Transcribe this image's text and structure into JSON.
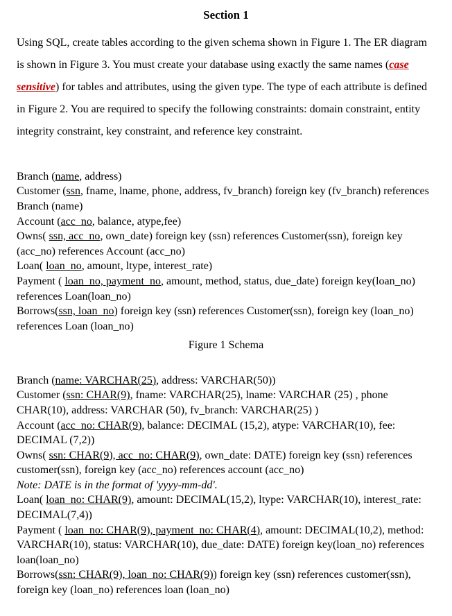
{
  "section_title": "Section 1",
  "intro": {
    "part1": "Using SQL, create tables according to the given schema shown in Figure 1. The ER diagram is shown in Figure 3.  You must create your database using exactly the same names (",
    "case_sensitive": "case sensitive",
    "part2": ") for tables and attributes, using the given type.  The type of each attribute is defined in Figure 2.  You are required to specify the following constraints: domain constraint, entity integrity constraint, key constraint, and reference key constraint."
  },
  "schema1": {
    "branch_pre": "Branch (",
    "branch_key": "name",
    "branch_post": ", address)",
    "customer_pre": "Customer (",
    "customer_key": "ssn",
    "customer_post": ", fname, lname, phone, address, fv_branch) foreign key (fv_branch) references Branch (name)",
    "account_pre": "Account (",
    "account_key": "acc_no",
    "account_post": ",  balance, atype,fee)",
    "owns_pre": "Owns( ",
    "owns_key": "ssn, acc_no",
    "owns_post": ", own_date) foreign key (ssn) references Customer(ssn),  foreign key (acc_no) references Account (acc_no)",
    "loan_pre": "Loan( ",
    "loan_key": "loan_no",
    "loan_post": ", amount, ltype, interest_rate)",
    "payment_pre": "Payment ( ",
    "payment_key": "loan_no, payment_no",
    "payment_post": ", amount, method, status, due_date) foreign key(loan_no) references Loan(loan_no)",
    "borrows_pre": "Borrows(",
    "borrows_key": "ssn, loan_no",
    "borrows_post": ") foreign key (ssn) references Customer(ssn),  foreign key (loan_no) references Loan (loan_no)"
  },
  "figure1_caption": "Figure 1 Schema",
  "schema2": {
    "branch_pre": "Branch (",
    "branch_key": "name: VARCHAR(25)",
    "branch_post": ", address: VARCHAR(50))",
    "customer_pre": "Customer (",
    "customer_key": "ssn: CHAR(9)",
    "customer_post": ", fname: VARCHAR(25), lname: VARCHAR (25) , phone CHAR(10), address: VARCHAR (50), fv_branch: VARCHAR(25) )",
    "account_pre": "Account (",
    "account_key": "acc_no: CHAR(9)",
    "account_post": ",  balance: DECIMAL (15,2), atype: VARCHAR(10), fee: DECIMAL (7,2))",
    "owns_pre": "Owns( ",
    "owns_key": "ssn: CHAR(9), acc_no: CHAR(9)",
    "owns_post": ", own_date: DATE) foreign key (ssn) references customer(ssn),  foreign key (acc_no) references account (acc_no)",
    "note": "Note: DATE is in the format of 'yyyy-mm-dd'.",
    "loan_pre": "Loan( ",
    "loan_key": "loan_no: CHAR(9)",
    "loan_post": ", amount: DECIMAL(15,2), ltype: VARCHAR(10), interest_rate: DECIMAL(7,4))",
    "payment_pre": "Payment ( ",
    "payment_key": "loan_no: CHAR(9), payment_no: CHAR(4)",
    "payment_post": ", amount: DECIMAL(10,2), method: VARCHAR(10), status: VARCHAR(10), due_date: DATE) foreign key(loan_no) references loan(loan_no)",
    "borrows_pre": "Borrows(",
    "borrows_key": "ssn: CHAR(9), loan_no: CHAR(9)",
    "borrows_post": ") foreign key (ssn) references customer(ssn),  foreign key (loan_no) references loan (loan_no)"
  }
}
